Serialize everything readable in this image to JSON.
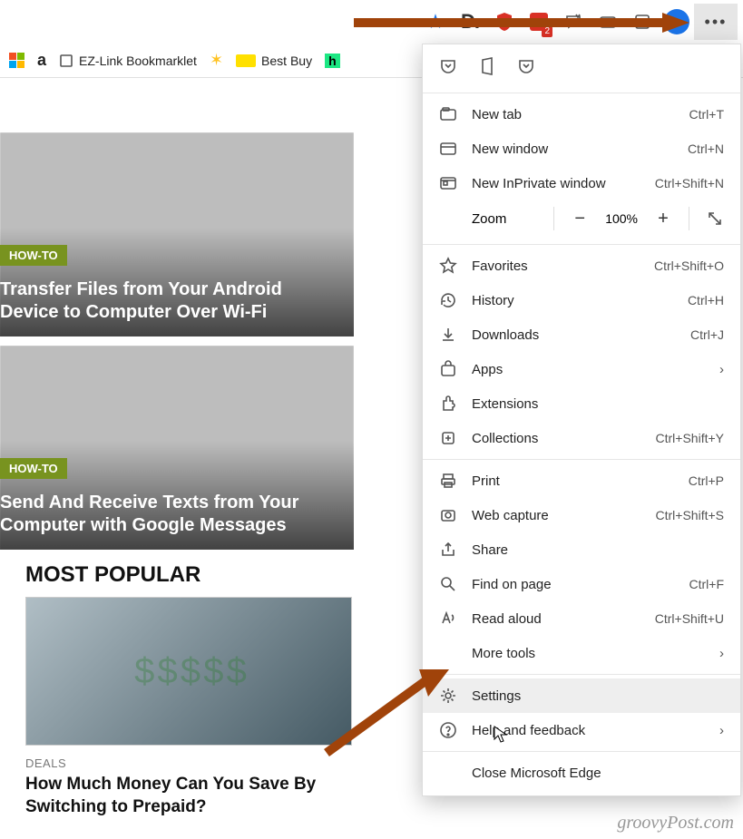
{
  "toolbar": {
    "d_label": "D.",
    "badge2": "2"
  },
  "bookmarks": {
    "ezlink": "EZ-Link Bookmarklet",
    "bestbuy": "Best Buy"
  },
  "articles": [
    {
      "tag": "HOW-TO",
      "title": "Transfer Files from Your Android Device to Computer Over Wi-Fi"
    },
    {
      "tag": "HOW-TO",
      "title": "Send And Receive Texts from Your Computer with Google Messages"
    }
  ],
  "most_popular": {
    "heading": "MOST POPULAR",
    "category": "DEALS",
    "headline": "How Much Money Can You Save By Switching to Prepaid?"
  },
  "menu": {
    "new_tab": "New tab",
    "new_tab_sc": "Ctrl+T",
    "new_window": "New window",
    "new_window_sc": "Ctrl+N",
    "new_inprivate": "New InPrivate window",
    "new_inprivate_sc": "Ctrl+Shift+N",
    "zoom_label": "Zoom",
    "zoom_value": "100%",
    "favorites": "Favorites",
    "favorites_sc": "Ctrl+Shift+O",
    "history": "History",
    "history_sc": "Ctrl+H",
    "downloads": "Downloads",
    "downloads_sc": "Ctrl+J",
    "apps": "Apps",
    "extensions": "Extensions",
    "collections": "Collections",
    "collections_sc": "Ctrl+Shift+Y",
    "print": "Print",
    "print_sc": "Ctrl+P",
    "webcapture": "Web capture",
    "webcapture_sc": "Ctrl+Shift+S",
    "share": "Share",
    "find": "Find on page",
    "find_sc": "Ctrl+F",
    "readaloud": "Read aloud",
    "readaloud_sc": "Ctrl+Shift+U",
    "moretools": "More tools",
    "settings": "Settings",
    "help": "Help and feedback",
    "close": "Close Microsoft Edge"
  },
  "watermark": "groovyPost.com"
}
